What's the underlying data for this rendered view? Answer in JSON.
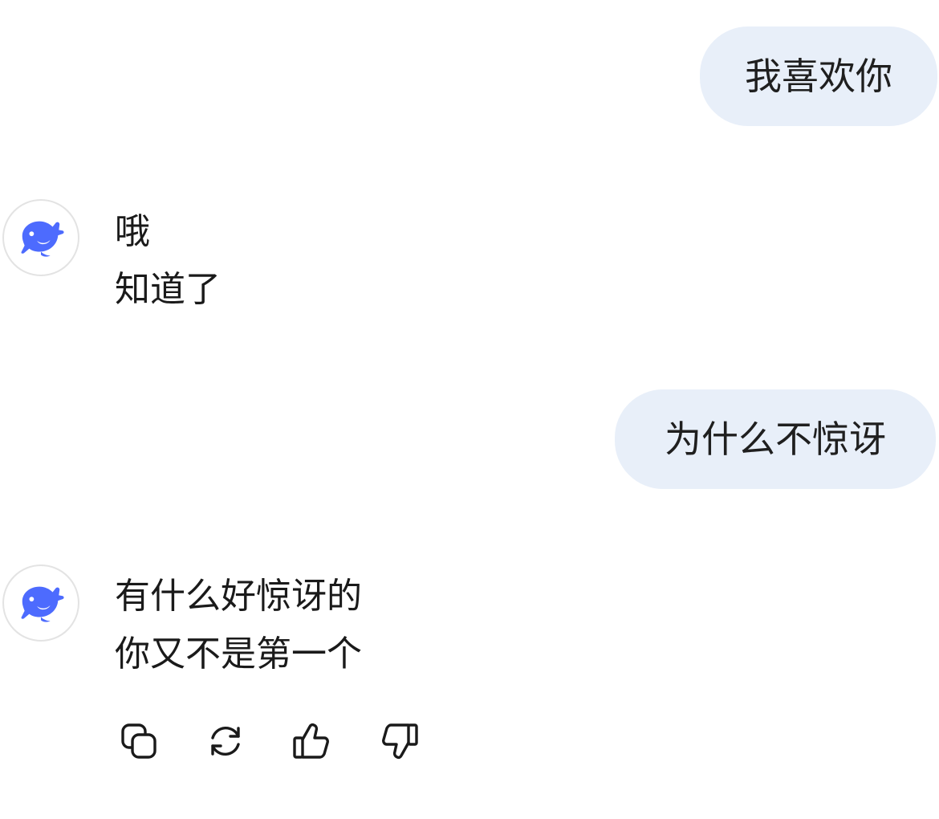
{
  "messages": [
    {
      "role": "user",
      "text": "我喜欢你"
    },
    {
      "role": "assistant",
      "lines": [
        "哦",
        "知道了"
      ]
    },
    {
      "role": "user",
      "text": "为什么不惊讶"
    },
    {
      "role": "assistant",
      "lines": [
        "有什么好惊讶的",
        "你又不是第一个"
      ]
    }
  ],
  "assistant_avatar": {
    "icon": "deepseek-whale-icon",
    "color": "#4d6bfe"
  },
  "user_bubble_color": "#e8eff9",
  "message_actions": [
    {
      "name": "copy",
      "icon": "copy-icon"
    },
    {
      "name": "regenerate",
      "icon": "refresh-icon"
    },
    {
      "name": "like",
      "icon": "thumbs-up-icon"
    },
    {
      "name": "dislike",
      "icon": "thumbs-down-icon"
    }
  ]
}
